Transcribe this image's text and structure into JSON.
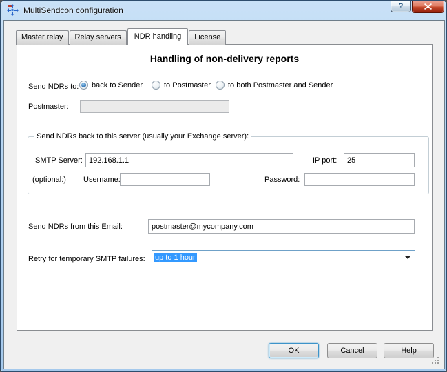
{
  "window": {
    "title": "MultiSendcon configuration"
  },
  "icons": {
    "app": "multisendcon-logo",
    "help": "?",
    "close": "✕",
    "dropdown": "▼"
  },
  "tabs": {
    "items": [
      "Master relay",
      "Relay servers",
      "NDR handling",
      "License"
    ],
    "active": "NDR handling"
  },
  "panel": {
    "heading": "Handling of non-delivery reports",
    "send_ndrs_to": {
      "label": "Send NDRs to:",
      "options": [
        {
          "label": "back to Sender",
          "selected": true
        },
        {
          "label": "to Postmaster",
          "selected": false
        },
        {
          "label": "to both Postmaster and Sender",
          "selected": false
        }
      ]
    },
    "postmaster": {
      "label": "Postmaster:",
      "value": "",
      "disabled": true
    },
    "server_group": {
      "title": "Send NDRs back to this server (usually your Exchange server):",
      "smtp_server": {
        "label": "SMTP Server:",
        "value": "192.168.1.1"
      },
      "ip_port": {
        "label": "IP port:",
        "value": "25"
      },
      "optional_label": "(optional:)",
      "username": {
        "label": "Username:",
        "value": ""
      },
      "password": {
        "label": "Password:",
        "value": ""
      }
    },
    "from_email": {
      "label": "Send NDRs from this Email:",
      "value": "postmaster@mycompany.com"
    },
    "retry": {
      "label": "Retry for temporary SMTP failures:",
      "selected_value": "up to 1 hour"
    }
  },
  "footer": {
    "ok": "OK",
    "cancel": "Cancel",
    "help": "Help"
  }
}
